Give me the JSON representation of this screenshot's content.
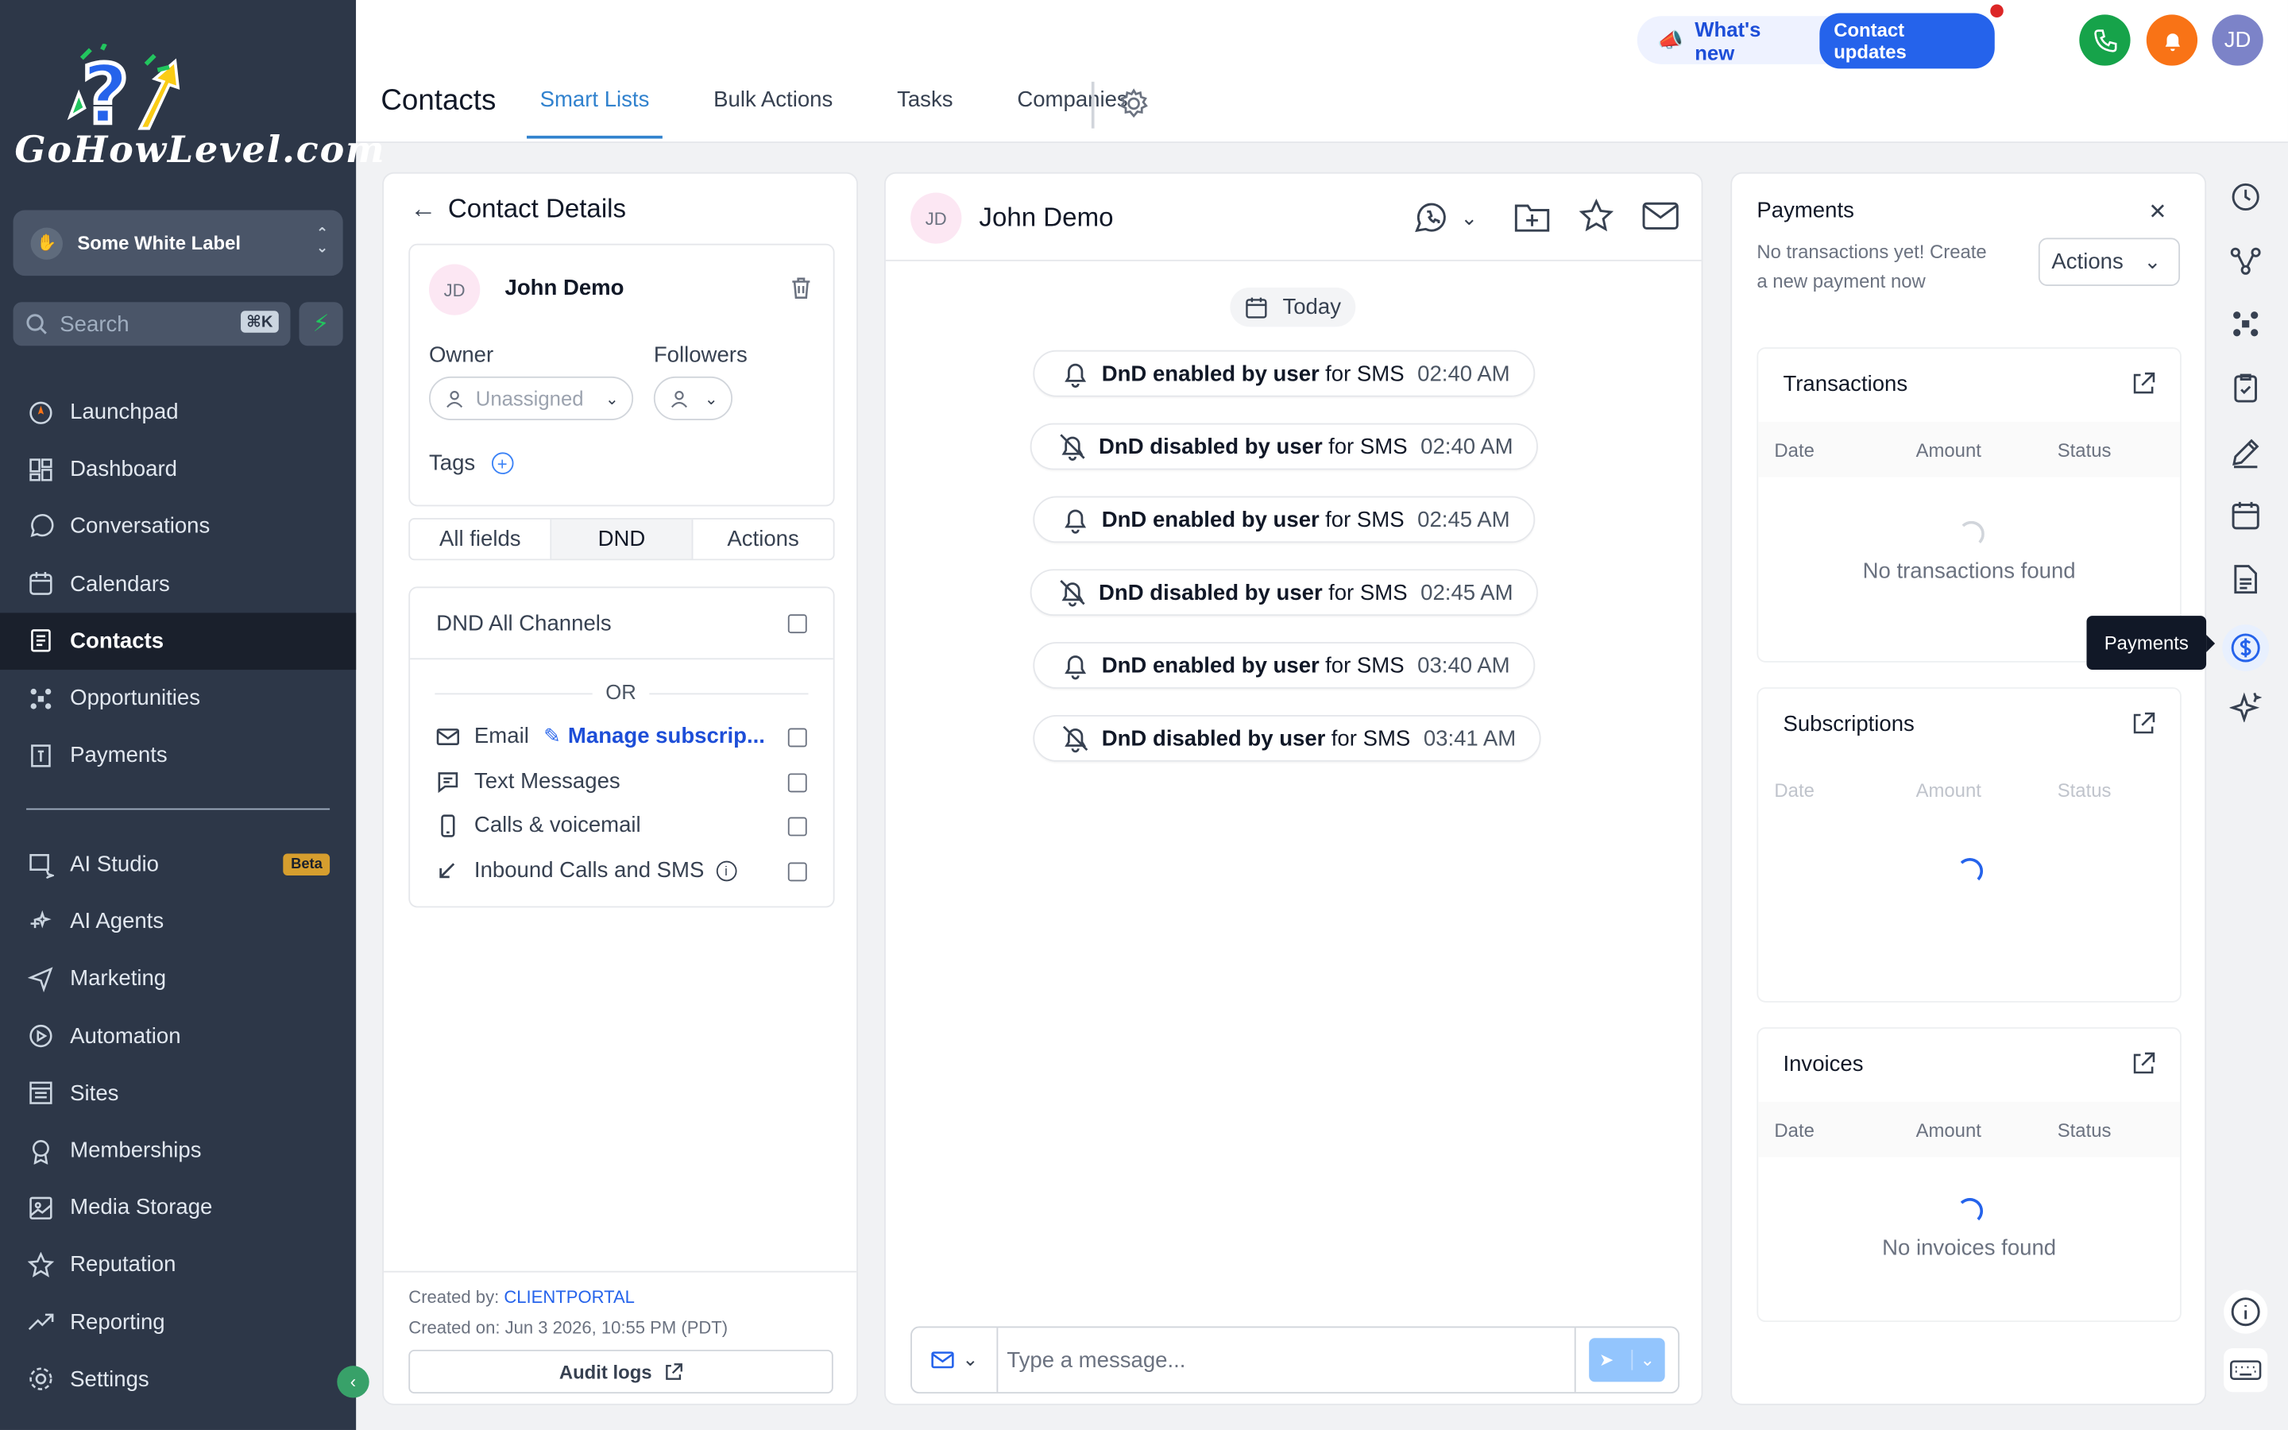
{
  "brand": {
    "logo_text": "GoHowLevel.com"
  },
  "sidebar": {
    "account": "Some White Label",
    "search_placeholder": "Search",
    "search_shortcut": "⌘K",
    "items": [
      {
        "label": "Launchpad",
        "icon": "rocket-icon"
      },
      {
        "label": "Dashboard",
        "icon": "dashboard-icon"
      },
      {
        "label": "Conversations",
        "icon": "chat-icon"
      },
      {
        "label": "Calendars",
        "icon": "calendar-icon"
      },
      {
        "label": "Contacts",
        "icon": "contacts-icon",
        "active": true
      },
      {
        "label": "Opportunities",
        "icon": "opportunities-icon"
      },
      {
        "label": "Payments",
        "icon": "payments-icon"
      }
    ],
    "items2": [
      {
        "label": "AI Studio",
        "icon": "ai-studio-icon",
        "badge": "Beta"
      },
      {
        "label": "AI Agents",
        "icon": "ai-agents-icon"
      },
      {
        "label": "Marketing",
        "icon": "send-icon"
      },
      {
        "label": "Automation",
        "icon": "automation-icon"
      },
      {
        "label": "Sites",
        "icon": "sites-icon"
      },
      {
        "label": "Memberships",
        "icon": "memberships-icon"
      },
      {
        "label": "Media Storage",
        "icon": "image-icon"
      },
      {
        "label": "Reputation",
        "icon": "star-icon"
      },
      {
        "label": "Reporting",
        "icon": "trend-icon"
      },
      {
        "label": "Settings",
        "icon": "gear-icon"
      }
    ]
  },
  "header": {
    "title": "Contacts",
    "tabs": [
      "Smart Lists",
      "Bulk Actions",
      "Tasks",
      "Companies"
    ],
    "active_tab": "Smart Lists",
    "whats_new": "What's new",
    "contact_updates": "Contact updates",
    "user_initials": "JD"
  },
  "contact_details": {
    "heading": "Contact Details",
    "initials": "JD",
    "name": "John Demo",
    "owner_label": "Owner",
    "owner_value": "Unassigned",
    "followers_label": "Followers",
    "tags_label": "Tags",
    "segments": [
      "All fields",
      "DND",
      "Actions"
    ],
    "active_segment": "DND",
    "dnd_all": "DND All Channels",
    "or_text": "OR",
    "channels": [
      {
        "label": "Email",
        "link": "Manage subscrip..."
      },
      {
        "label": "Text Messages"
      },
      {
        "label": "Calls & voicemail"
      },
      {
        "label": "Inbound Calls and SMS"
      }
    ],
    "created_by_label": "Created by:",
    "created_by": "CLIENTPORTAL",
    "created_on": "Created on: Jun 3 2026, 10:55 PM (PDT)",
    "audit_logs": "Audit logs"
  },
  "conversation": {
    "initials": "JD",
    "name": "John Demo",
    "day": "Today",
    "events": [
      {
        "bold": "DnD enabled by user",
        "rest": "for SMS",
        "time": "02:40 AM",
        "icon": "bell-icon"
      },
      {
        "bold": "DnD disabled by user",
        "rest": "for SMS",
        "time": "02:40 AM",
        "icon": "bell-off-icon"
      },
      {
        "bold": "DnD enabled by user",
        "rest": "for SMS",
        "time": "02:45 AM",
        "icon": "bell-icon"
      },
      {
        "bold": "DnD disabled by user",
        "rest": "for SMS",
        "time": "02:45 AM",
        "icon": "bell-off-icon"
      },
      {
        "bold": "DnD enabled by user",
        "rest": "for SMS",
        "time": "03:40 AM",
        "icon": "bell-icon"
      },
      {
        "bold": "DnD disabled by user",
        "rest": "for SMS",
        "time": "03:41 AM",
        "icon": "bell-off-icon"
      }
    ],
    "message_placeholder": "Type a message..."
  },
  "payments": {
    "title": "Payments",
    "subtitle": "No transactions yet! Create a new payment now",
    "actions": "Actions",
    "columns": [
      "Date",
      "Amount",
      "Status"
    ],
    "transactions_title": "Transactions",
    "transactions_empty": "No transactions found",
    "subscriptions_title": "Subscriptions",
    "invoices_title": "Invoices",
    "invoices_empty": "No invoices found",
    "tooltip": "Payments"
  },
  "colors": {
    "accent": "#3182ce",
    "sidebar": "#2d3748",
    "phone": "#16a34a",
    "bell": "#f97316",
    "avatar": "#7c83c8"
  }
}
